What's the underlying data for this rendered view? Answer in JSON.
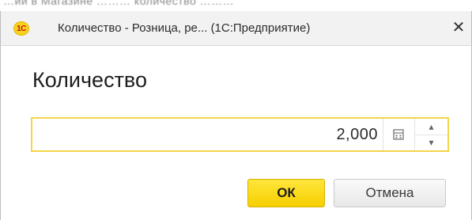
{
  "background": {
    "text": "…ии в Магазине ……… количество ………"
  },
  "window": {
    "app_logo": "1С",
    "title": "Количество - Розница, ре... (1С:Предприятие)",
    "close_icon": "✕"
  },
  "dialog": {
    "heading": "Количество",
    "quantity_value": "2,000"
  },
  "buttons": {
    "ok_label": "ОК",
    "cancel_label": "Отмена"
  },
  "colors": {
    "field_border": "#f5d547",
    "ok_button": "#f6cf00",
    "logo": "#f7d21c"
  },
  "icons": [
    "calculator-icon",
    "spin-up-icon",
    "spin-down-icon",
    "close-icon",
    "app-logo"
  ]
}
